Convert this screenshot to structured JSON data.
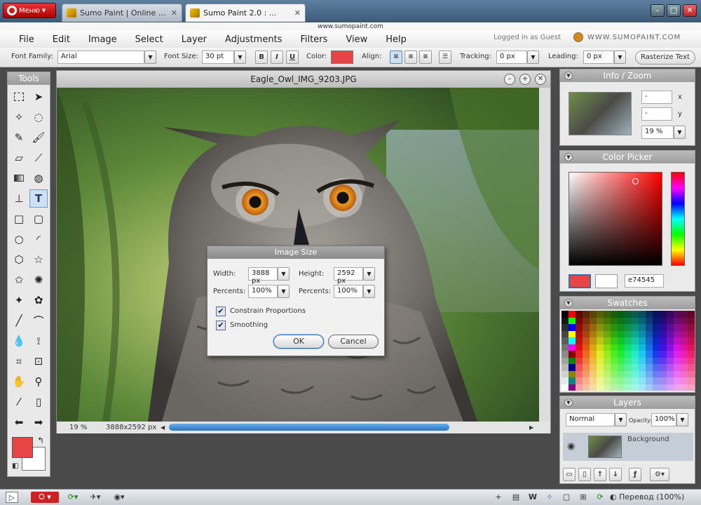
{
  "browser": {
    "menu_label": "Меню",
    "tabs": [
      {
        "label": "Sumo Paint | Online Imag..."
      },
      {
        "label": "Sumo Paint 2.0 : ..."
      }
    ],
    "url": "www.sumopaint.com",
    "min_glyph": "–",
    "max_glyph": "□",
    "close_glyph": "✕"
  },
  "menubar": {
    "items": [
      "File",
      "Edit",
      "Image",
      "Select",
      "Layer",
      "Adjustments",
      "Filters",
      "View",
      "Help"
    ],
    "logged": "Logged in as Guest",
    "brand": "WWW.SUMOPAINT.COM"
  },
  "options": {
    "font_family_label": "Font Family:",
    "font_family_value": "Arial",
    "font_size_label": "Font Size:",
    "font_size_value": "30 pt",
    "bold": "B",
    "italic": "I",
    "underline": "U",
    "color_label": "Color:",
    "color_value": "#e74545",
    "align_label": "Align:",
    "tracking_label": "Tracking:",
    "tracking_value": "0 px",
    "leading_label": "Leading:",
    "leading_value": "0 px",
    "rasterize": "Rasterize Text"
  },
  "tools": {
    "title": "Tools",
    "fg_color": "#e74545",
    "bg_color": "#ffffff"
  },
  "document": {
    "title": "Eagle_Owl_IMG_9203.JPG",
    "zoom": "19 %",
    "dimensions": "3888x2592 px"
  },
  "dialog": {
    "title": "Image Size",
    "width_label": "Width:",
    "width_value": "3888 px",
    "height_label": "Height:",
    "height_value": "2592 px",
    "percents_label": "Percents:",
    "percents_w": "100%",
    "percents_h": "100%",
    "constrain": "Constrain Proportions",
    "smoothing": "Smoothing",
    "ok": "OK",
    "cancel": "Cancel"
  },
  "info_panel": {
    "title": "Info / Zoom",
    "x_value": "-",
    "x_label": "x",
    "y_value": "-",
    "y_label": "y",
    "zoom": "19 %"
  },
  "color_picker": {
    "title": "Color Picker",
    "hex": "e74545",
    "current": "#e74545"
  },
  "swatches": {
    "title": "Swatches"
  },
  "layers": {
    "title": "Layers",
    "blend": "Normal",
    "opacity_label": "Opacity:",
    "opacity_value": "100%",
    "layer_name": "Background"
  },
  "bottombar": {
    "translate": "Перевод (100%)"
  }
}
